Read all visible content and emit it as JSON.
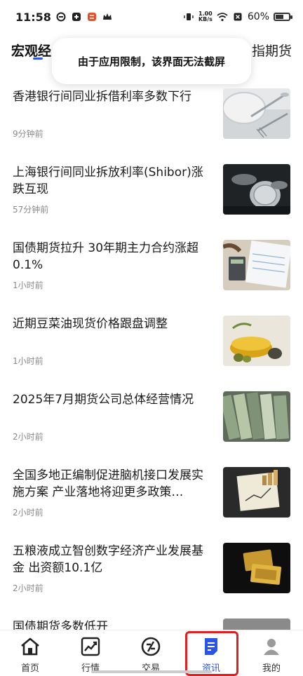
{
  "status_bar": {
    "time": "11:58",
    "net_speed_value": "1.00",
    "net_speed_unit": "KB/s",
    "battery": "60%",
    "battery_level": 0.6
  },
  "tabs": {
    "left_label": "宏观经",
    "right_label": "指期货"
  },
  "toast": {
    "message": "由于应用限制，该界面无法截屏"
  },
  "news": [
    {
      "title": "香港银行间同业拆借利率多数下行",
      "time": "9分钟前"
    },
    {
      "title": "上海银行间同业拆放利率(Shibor)涨跌互现",
      "time": "57分钟前"
    },
    {
      "title": "国债期货拉升 30年期主力合约涨超0.1%",
      "time": "1小时前"
    },
    {
      "title": "近期豆菜油现货价格跟盘调整",
      "time": "1小时前"
    },
    {
      "title": "2025年7月期货公司总体经营情况",
      "time": "2小时前"
    },
    {
      "title": "全国多地正编制促进脑机接口发展实施方案 产业落地将迎更多政策…",
      "time": "2小时前"
    },
    {
      "title": "五粮液成立智创数字经济产业发展基金 出资额10.1亿",
      "time": "2小时前"
    },
    {
      "title": "国债期货多数低开",
      "time": ""
    }
  ],
  "bottom_nav": {
    "items": [
      {
        "label": "首页",
        "icon": "home-icon"
      },
      {
        "label": "行情",
        "icon": "chart-icon"
      },
      {
        "label": "交易",
        "icon": "trade-icon"
      },
      {
        "label": "资讯",
        "icon": "news-icon"
      },
      {
        "label": "我的",
        "icon": "profile-icon"
      }
    ],
    "active_index": 3
  },
  "colors": {
    "accent": "#2855e8",
    "highlight": "#e02020",
    "time_text": "#8a8a8a"
  }
}
